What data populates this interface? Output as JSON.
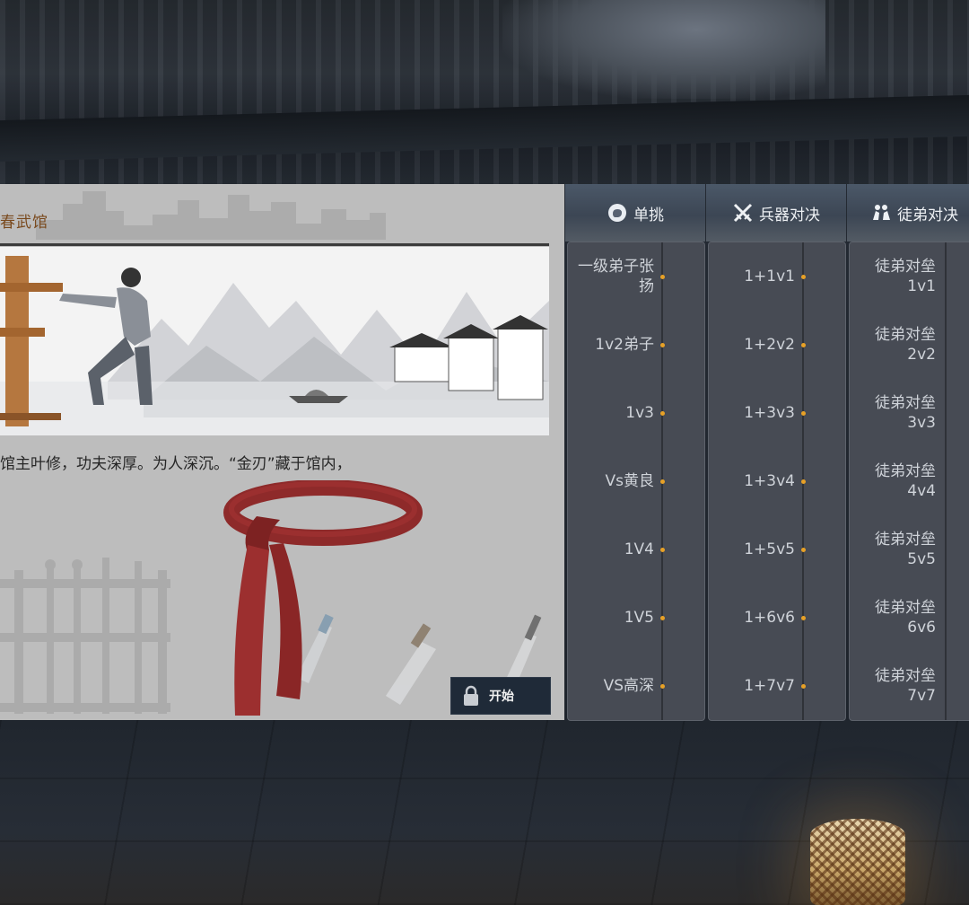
{
  "left_panel": {
    "hall_title": "春武馆",
    "description": "馆主叶修，功夫深厚。为人深沉。“金刃”藏于馆内，",
    "start_button": {
      "label": "开始",
      "icon": "lock-icon"
    }
  },
  "columns": [
    {
      "id": "duel",
      "title": "单挑",
      "icon": "fist-icon",
      "items": [
        "一级弟子张扬",
        "1v2弟子",
        "1v3",
        "Vs黄良",
        "1V4",
        "1V5",
        "VS高深"
      ]
    },
    {
      "id": "weapon",
      "title": "兵器对决",
      "icon": "crossed-swords-icon",
      "items": [
        "1+1v1",
        "1+2v2",
        "1+3v3",
        "1+3v4",
        "1+5v5",
        "1+6v6",
        "1+7v7"
      ]
    },
    {
      "id": "disciple",
      "title": "徒弟对决",
      "icon": "disciples-icon",
      "items": [
        "徒弟对垒1v1",
        "徒弟对垒2v2",
        "徒弟对垒3v3",
        "徒弟对垒4v4",
        "徒弟对垒5v5",
        "徒弟对垒6v6",
        "徒弟对垒7v7"
      ]
    }
  ],
  "colors": {
    "accent_dot": "#e8a126",
    "panel_bg": "#bdbdbd",
    "column_bg": "#474b54",
    "title_text": "#7a4a1e"
  }
}
